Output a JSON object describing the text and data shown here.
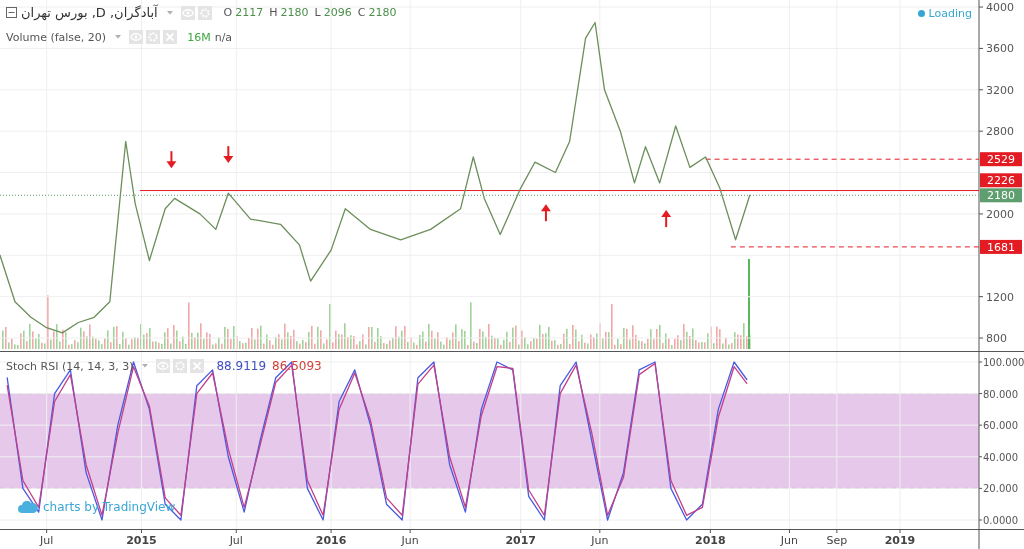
{
  "price_pane": {
    "legend": {
      "symbol": "آبادگران, D, بورس تهران",
      "ohlc": [
        {
          "label": "O",
          "value": "2117"
        },
        {
          "label": "H",
          "value": "2180"
        },
        {
          "label": "L",
          "value": "2096"
        },
        {
          "label": "C",
          "value": "2180"
        }
      ]
    },
    "volume_legend": {
      "title": "Volume (false, 20)",
      "value": "16M",
      "extra": "n/a"
    },
    "status": "Loading",
    "chart_data": {
      "type": "line",
      "x": [
        2014.254,
        2014.333,
        2014.417,
        2014.5,
        2014.583,
        2014.667,
        2014.75,
        2014.833,
        2014.917,
        2014.967,
        2015.042,
        2015.125,
        2015.175,
        2015.308,
        2015.392,
        2015.458,
        2015.575,
        2015.733,
        2015.833,
        2015.892,
        2016.0,
        2016.075,
        2016.208,
        2016.367,
        2016.525,
        2016.683,
        2016.75,
        2016.808,
        2016.892,
        2017.0,
        2017.075,
        2017.183,
        2017.258,
        2017.342,
        2017.392,
        2017.442,
        2017.525,
        2017.6,
        2017.658,
        2017.733,
        2017.817,
        2017.892,
        2017.975,
        2018.05,
        2018.133,
        2018.208
      ],
      "series": [
        {
          "color": "#6b8e5a",
          "values": [
            1600,
            1150,
            1000,
            900,
            850,
            950,
            1000,
            1150,
            2700,
            2100,
            1550,
            2050,
            2150,
            2000,
            1850,
            2200,
            1950,
            1900,
            1700,
            1350,
            1650,
            2050,
            1850,
            1750,
            1850,
            2050,
            2550,
            2150,
            1800,
            2250,
            2500,
            2400,
            2700,
            3700,
            3850,
            3200,
            2800,
            2300,
            2650,
            2300,
            2850,
            2450,
            2550,
            2250,
            1750,
            2180
          ]
        }
      ],
      "xlim": [
        2014.254,
        2019.654
      ],
      "ylim": [
        665,
        4068
      ],
      "yticks": [
        800,
        1200,
        2000,
        2800,
        3200,
        3600,
        4000
      ],
      "grid": true,
      "ref_lines": [
        {
          "axis": "y",
          "value": 2226,
          "label": "2226",
          "color": "#e31b23"
        },
        {
          "axis": "y",
          "value": 2529,
          "label": "2529",
          "color": "#e31b23"
        },
        {
          "axis": "y",
          "value": 1681,
          "label": "1681",
          "color": "#e31b23"
        },
        {
          "axis": "y",
          "value": 2180,
          "label": "2180",
          "color": "#5f9e6e"
        }
      ]
    }
  },
  "stoch_pane": {
    "legend": {
      "title": "Stoch RSI (14, 14, 3, 3)",
      "values": [
        {
          "text": "88.9119",
          "color": "#3f4fc0"
        },
        {
          "text": "86.5093",
          "color": "#d0403a"
        }
      ]
    },
    "branding": "charts by TradingView",
    "chart_data": {
      "type": "line",
      "x": [
        2014.292,
        2014.375,
        2014.458,
        2014.542,
        2014.625,
        2014.708,
        2014.792,
        2014.875,
        2014.958,
        2015.042,
        2015.125,
        2015.208,
        2015.292,
        2015.375,
        2015.458,
        2015.542,
        2015.625,
        2015.708,
        2015.792,
        2015.875,
        2015.958,
        2016.042,
        2016.125,
        2016.208,
        2016.292,
        2016.375,
        2016.458,
        2016.542,
        2016.625,
        2016.708,
        2016.792,
        2016.875,
        2016.958,
        2017.042,
        2017.125,
        2017.208,
        2017.292,
        2017.375,
        2017.458,
        2017.542,
        2017.625,
        2017.708,
        2017.792,
        2017.875,
        2017.958,
        2018.042,
        2018.125,
        2018.192
      ],
      "series": [
        {
          "color": "#4a5ae0",
          "values": [
            90,
            20,
            5,
            80,
            95,
            30,
            0,
            60,
            100,
            70,
            10,
            0,
            85,
            95,
            40,
            5,
            50,
            90,
            100,
            20,
            0,
            75,
            95,
            60,
            10,
            0,
            90,
            100,
            35,
            5,
            70,
            100,
            95,
            15,
            0,
            85,
            100,
            50,
            0,
            30,
            95,
            100,
            20,
            0,
            10,
            70,
            100,
            88.9
          ]
        },
        {
          "color": "#c2408a",
          "values": [
            85,
            25,
            8,
            75,
            92,
            35,
            3,
            55,
            97,
            72,
            14,
            3,
            80,
            93,
            45,
            8,
            47,
            87,
            98,
            25,
            3,
            70,
            93,
            63,
            14,
            3,
            86,
            98,
            40,
            8,
            66,
            97,
            96,
            19,
            3,
            80,
            98,
            55,
            3,
            27,
            92,
            99,
            25,
            3,
            8,
            65,
            97,
            86.5
          ]
        }
      ],
      "xlim": [
        2014.254,
        2019.654
      ],
      "ylim": [
        -5.7,
        106.3
      ],
      "grid": true,
      "yticks": [
        {
          "value": 100,
          "label": "100.000"
        },
        {
          "value": 80,
          "label": "80.000"
        },
        {
          "value": 60,
          "label": "60.000"
        },
        {
          "value": 40,
          "label": "40.000"
        },
        {
          "value": 20,
          "label": "20.000"
        },
        {
          "value": 0,
          "label": "0.0000"
        }
      ],
      "xticks": [
        {
          "value": 2014.5,
          "label": "Jul"
        },
        {
          "value": 2015,
          "label": "2015"
        },
        {
          "value": 2015.5,
          "label": "Jul"
        },
        {
          "value": 2016,
          "label": "2016"
        },
        {
          "value": 2016.417,
          "label": "Jun"
        },
        {
          "value": 2017,
          "label": "2017"
        },
        {
          "value": 2017.417,
          "label": "Jun"
        },
        {
          "value": 2018,
          "label": "2018"
        },
        {
          "value": 2018.417,
          "label": "Jun"
        },
        {
          "value": 2018.667,
          "label": "Sep"
        },
        {
          "value": 2019,
          "label": "2019"
        }
      ],
      "bands": [
        {
          "axis": "y",
          "from": 20,
          "to": 80,
          "color": "#e6c8eb"
        }
      ]
    }
  }
}
